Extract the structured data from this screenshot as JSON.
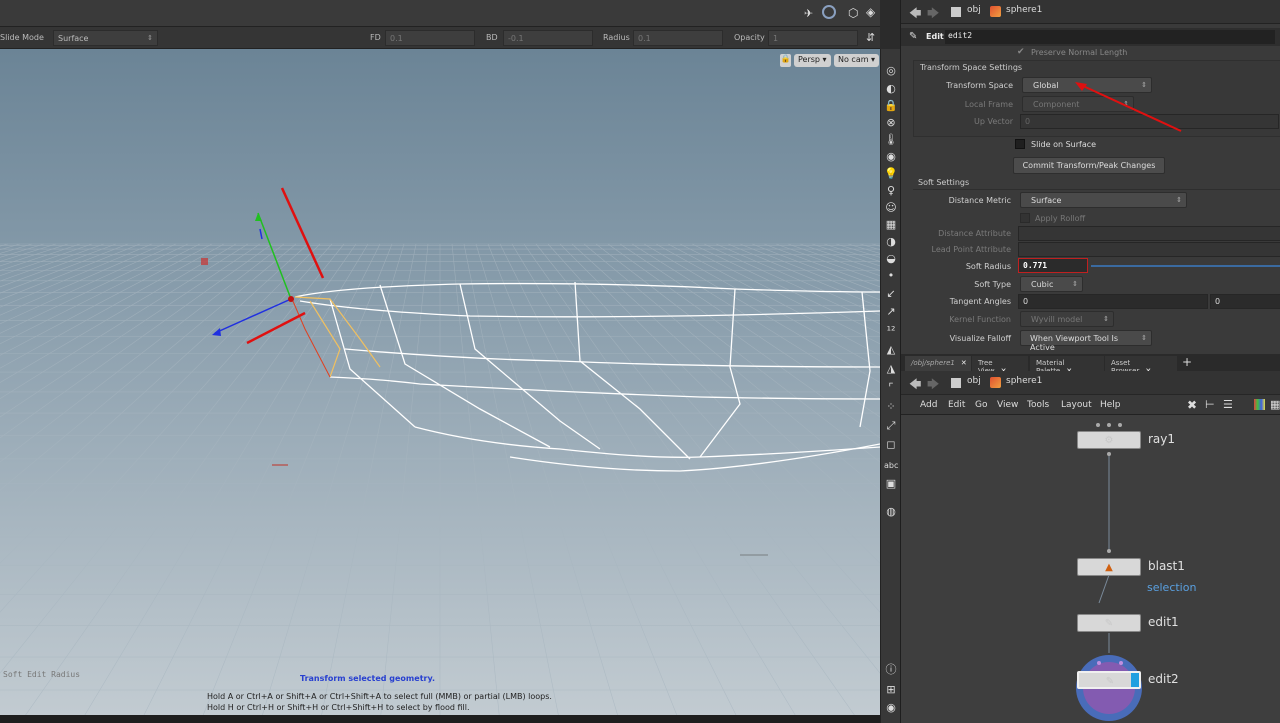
{
  "viewport": {
    "options": {
      "slide_mode_label": "Slide Mode",
      "slide_mode_value": "Surface",
      "fd_label": "FD",
      "fd_value": "0.1",
      "bd_label": "BD",
      "bd_value": "-0.1",
      "radius_label": "Radius",
      "radius_value": "0.1",
      "opacity_label": "Opacity",
      "opacity_value": "1"
    },
    "camera_persp": "Persp",
    "camera_nocam": "No cam",
    "soft_edit_label": "Soft Edit Radius",
    "message": "Transform selected geometry.",
    "hint_line1": "Hold A or Ctrl+A or Shift+A or Ctrl+Shift+A to select full (MMB) or partial (LMB) loops.",
    "hint_line2": "Hold H or Ctrl+H or Shift+H or Ctrl+Shift+H to select by flood fill.",
    "toolbar_abc": "abc"
  },
  "params": {
    "path": {
      "obj": "obj",
      "node": "sphere1"
    },
    "node_type": "Edit",
    "node_name": "edit2",
    "preserve_normal_length": "Preserve Normal Length",
    "transform_space_settings": "Transform Space Settings",
    "transform_space_label": "Transform Space",
    "transform_space_value": "Global",
    "local_frame_label": "Local Frame",
    "local_frame_value": "Component",
    "up_vector_label": "Up Vector",
    "up_vector_value": "0",
    "slide_on_surface": "Slide on Surface",
    "commit_button": "Commit Transform/Peak Changes",
    "soft_settings": "Soft Settings",
    "distance_metric_label": "Distance Metric",
    "distance_metric_value": "Surface",
    "apply_rolloff": "Apply Rolloff",
    "distance_attribute_label": "Distance Attribute",
    "lead_point_attribute_label": "Lead Point Attribute",
    "soft_radius_label": "Soft Radius",
    "soft_radius_value": "0.771",
    "soft_type_label": "Soft Type",
    "soft_type_value": "Cubic",
    "tangent_angles_label": "Tangent Angles",
    "tangent_angle_1": "0",
    "tangent_angle_2": "0",
    "kernel_function_label": "Kernel Function",
    "kernel_function_value": "Wyvill model",
    "visualize_falloff_label": "Visualize Falloff",
    "visualize_falloff_value": "When Viewport Tool Is Active"
  },
  "network": {
    "tabs": [
      {
        "label": "/obj/sphere1"
      },
      {
        "label": "Tree View"
      },
      {
        "label": "Material Palette"
      },
      {
        "label": "Asset Browser"
      }
    ],
    "add_tab": "+",
    "path": {
      "obj": "obj",
      "node": "sphere1"
    },
    "menu": [
      "Add",
      "Edit",
      "Go",
      "View",
      "Tools",
      "Layout",
      "Help"
    ],
    "nodes": [
      {
        "name": "ray1"
      },
      {
        "name": "blast1",
        "sub": "selection"
      },
      {
        "name": "edit1"
      },
      {
        "name": "edit2"
      }
    ]
  }
}
